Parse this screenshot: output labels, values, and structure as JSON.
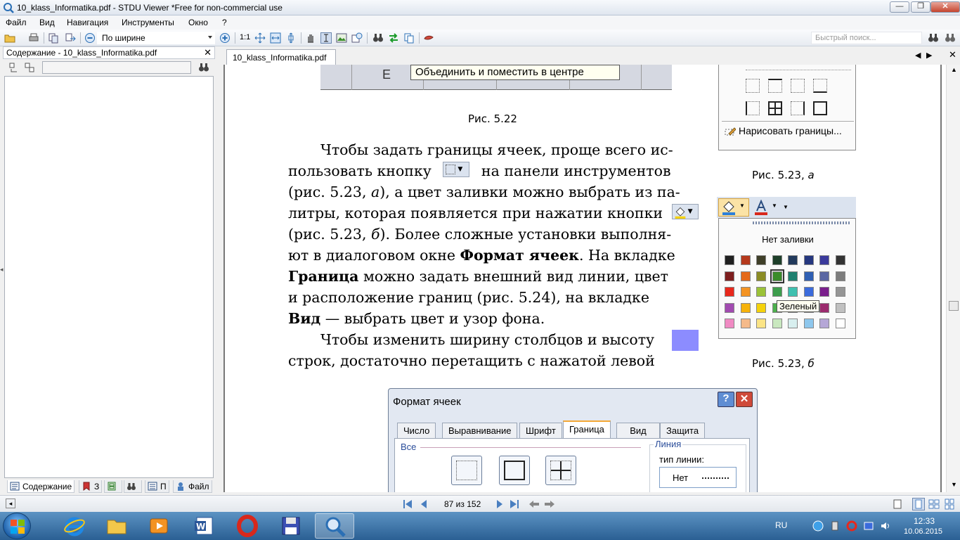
{
  "window": {
    "title": "10_klass_Informatika.pdf - STDU Viewer *Free for non-commercial use",
    "minimize_glyph": "—",
    "maximize_glyph": "❐",
    "close_glyph": "✕"
  },
  "menu": {
    "items": [
      "Файл",
      "Вид",
      "Навигация",
      "Инструменты",
      "Окно",
      "?"
    ]
  },
  "toolbar": {
    "zoom_mode": "По ширине",
    "actual_size_label": "1:1",
    "quick_search_placeholder": "Быстрый поиск..."
  },
  "left_panel": {
    "title": "Содержание - 10_klass_Informatika.pdf",
    "close_glyph": "✕",
    "tabs": [
      {
        "label": "Содержание",
        "icon": "contents-icon"
      },
      {
        "label": "З",
        "icon": "bookmarks-icon"
      },
      {
        "label": "",
        "icon": "thumbnails-icon"
      },
      {
        "label": "",
        "icon": "search-results-icon"
      },
      {
        "label": "П",
        "icon": "pages-icon"
      },
      {
        "label": "Файл",
        "icon": "file-icon"
      }
    ]
  },
  "document": {
    "tab_label": "10_klass_Informatika.pdf",
    "fig_522": {
      "column_letter": "E",
      "tooltip": "Объединить и поместить в центре",
      "caption": "Рис. 5.22"
    },
    "fig_523a": {
      "draw_borders_label": "Нарисовать границы...",
      "caption_prefix": "Рис. 5.23, ",
      "caption_letter": "а"
    },
    "fig_523b": {
      "no_fill_label": "Нет заливки",
      "tooltip": "Зеленый",
      "caption_prefix": "Рис. 5.23, ",
      "caption_letter": "б",
      "swatches": [
        [
          "#202020",
          "#b5391c",
          "#3e3e28",
          "#1e3f2a",
          "#223a5c",
          "#25377f",
          "#3b3a9c",
          "#333333"
        ],
        [
          "#7d1e1e",
          "#e46a1b",
          "#8b8c25",
          "#3a8c2a",
          "#1f8070",
          "#2f5fb3",
          "#5b67a3",
          "#7c7c7c"
        ],
        [
          "#e8281c",
          "#f39323",
          "#9bc238",
          "#3d9d4c",
          "#3fc0b0",
          "#3b6bdc",
          "#7a1e8c",
          "#959595"
        ],
        [
          "#a14ab0",
          "#f6b20b",
          "#f5d20b",
          "#4cb04c",
          "#48c8e6",
          "#2c9ad9",
          "#9b2b6e",
          "#c0c0c0"
        ],
        [
          "#f08ac3",
          "#f5ba8a",
          "#fbe486",
          "#c9e8bf",
          "#d8efef",
          "#8ec7ed",
          "#b5a7d6",
          "#ffffff"
        ]
      ]
    },
    "paragraph1": {
      "line1": "Чтобы задать границы ячеек, проще всего ис-",
      "line2a": "пользовать  кнопку",
      "line2b": "на панели инструментов",
      "line3a": "(рис. 5.23, ",
      "line3_italic": "а",
      "line3b": "), а цвет заливки можно выбрать из па-",
      "line4": "литры, которая появляется при нажатии кнопки",
      "line5a": "(рис. 5.23, ",
      "line5_italic": "б",
      "line5b": "). Более сложные установки выполня-",
      "line6a": "ют в диалоговом окне ",
      "line6_bold": "Формат ячеек",
      "line6b": ". На вкладке",
      "line7_bold": "Граница",
      "line7b": "  можно  задать внешний вид линии, цвет",
      "line8": "и  расположение границ (рис. 5.24), на вкладке",
      "line9_bold": "Вид",
      "line9b": " — выбрать цвет и узор фона."
    },
    "paragraph2": {
      "line1": "Чтобы   изменить ширину столбцов и высоту",
      "line2": "строк,   достаточно перетащить с нажатой левой"
    },
    "dialog": {
      "title": "Формат ячеек",
      "help_glyph": "?",
      "close_glyph": "✕",
      "tabs": [
        "Число",
        "Выравнивание",
        "Шрифт",
        "Граница",
        "Вид",
        "Защита"
      ],
      "active_tab": "Граница",
      "group_all": "Все",
      "group_line": "Линия",
      "line_type_label": "тип линии:",
      "line_type_value": "Нет"
    }
  },
  "status": {
    "page_info": "87 из 152"
  },
  "taskbar": {
    "lang": "RU",
    "time": "12:33",
    "date": "10.06.2015"
  },
  "colors": {
    "accent_highlight": "#8c8cff",
    "tooltip_bg": "#fffff0",
    "active_tab_border": "#f4a835"
  }
}
